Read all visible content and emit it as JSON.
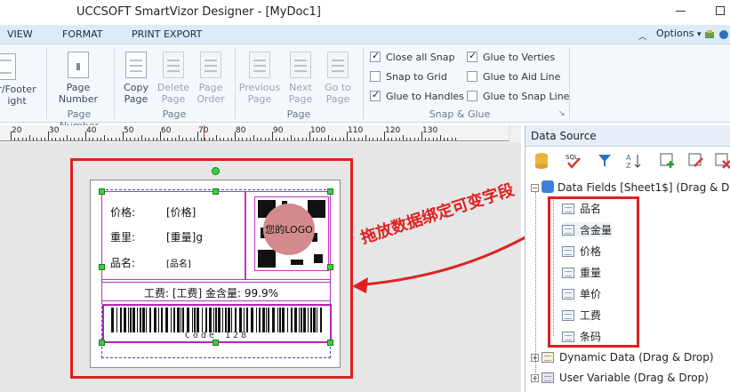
{
  "window": {
    "title": "UCCSOFT SmartVizor Designer - [MyDoc1]"
  },
  "menu": {
    "view": "VIEW",
    "format": "FORMAT",
    "print_export": "PRINT EXPORT",
    "options": "Options"
  },
  "ribbon": {
    "header_footer": {
      "line1": "r/Footer",
      "line2": "ight"
    },
    "page_number": {
      "line1": "Page",
      "line2": "Number"
    },
    "page_number_group": "Page Number",
    "copy_page": {
      "line1": "Copy",
      "line2": "Page"
    },
    "delete_page": {
      "line1": "Delete",
      "line2": "Page"
    },
    "page_order": {
      "line1": "Page",
      "line2": "Order"
    },
    "page_group": "Page",
    "previous_page": {
      "line1": "Previous",
      "line2": "Page"
    },
    "next_page": {
      "line1": "Next",
      "line2": "Page"
    },
    "go_to_page": {
      "line1": "Go to",
      "line2": "Page"
    },
    "page_group2": "Page",
    "snap": {
      "close_all_snap": "Close all Snap",
      "snap_to_grid": "Snap to Grid",
      "glue_to_handles": "Glue to Handles",
      "glue_to_verties": "Glue to Verties",
      "glue_to_aid_line": "Glue to Aid Line",
      "glue_to_snap_line": "Glue to Snap Line",
      "group": "Snap & Glue"
    }
  },
  "ruler": {
    "labels": [
      "20",
      "30",
      "40",
      "50",
      "60",
      "70",
      "80",
      "90",
      "100",
      "110",
      "120",
      "130"
    ]
  },
  "label": {
    "price_label": "价格:",
    "price_value": "[价格]",
    "weight_label": "重里:",
    "weight_value": "[重量]g",
    "name_label": "品名:",
    "name_value": "[品名]",
    "fee_line": "工费: [工费]   金含量: 99.9%",
    "logo_text": "您的LOGO",
    "barcode_text": "Code 128"
  },
  "annotation": "拖放数据绑定可变字段",
  "data_source": {
    "title": "Data Source",
    "data_fields": "Data Fields [Sheet1$]  (Drag & D",
    "fields": [
      "品名",
      "含金量",
      "价格",
      "重量",
      "单价",
      "工费",
      "条码"
    ],
    "dynamic_data": "Dynamic Data (Drag & Drop)",
    "user_variable": "User Variable (Drag & Drop)"
  },
  "colors": {
    "accent_red": "#e02020",
    "selection": "#3bd23b",
    "ribbon_bg": "#f4f8fc",
    "menu_bg": "#dcebf7"
  }
}
